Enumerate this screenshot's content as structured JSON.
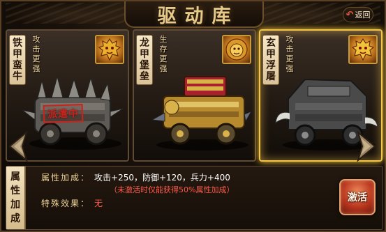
{
  "header": {
    "title": "驱动库",
    "back_label": "返回"
  },
  "cards": [
    {
      "name_chars": [
        "铁",
        "甲",
        "蛮",
        "牛"
      ],
      "perk_chars": [
        "攻",
        "击",
        "更",
        "强"
      ],
      "emblem_icon": "tiger-head-emblem",
      "stamp": "派遣中",
      "selected": false
    },
    {
      "name_chars": [
        "龙",
        "甲",
        "堡",
        "垒"
      ],
      "perk_chars": [
        "生",
        "存",
        "更",
        "强"
      ],
      "emblem_icon": "lion-head-emblem",
      "selected": false
    },
    {
      "name_chars": [
        "玄",
        "甲",
        "浮",
        "屠"
      ],
      "perk_chars": [
        "攻",
        "击",
        "更",
        "强"
      ],
      "emblem_icon": "tiger-head-emblem",
      "selected": true
    }
  ],
  "info": {
    "tab_chars": [
      "属",
      "性",
      "加",
      "成"
    ],
    "attr_label": "属性加成：",
    "attr_value": "攻击+250，防御+120，兵力+400",
    "attr_note": "（未激活时仅能获得50%属性加成）",
    "special_label": "特殊效果：",
    "special_value": "无"
  },
  "actions": {
    "activate_label": "激活"
  },
  "colors": {
    "gold_text": "#f0d59a",
    "red_text": "#ff5a4a",
    "selected_border": "#f3c64a",
    "stamp_red": "#c9241b"
  }
}
